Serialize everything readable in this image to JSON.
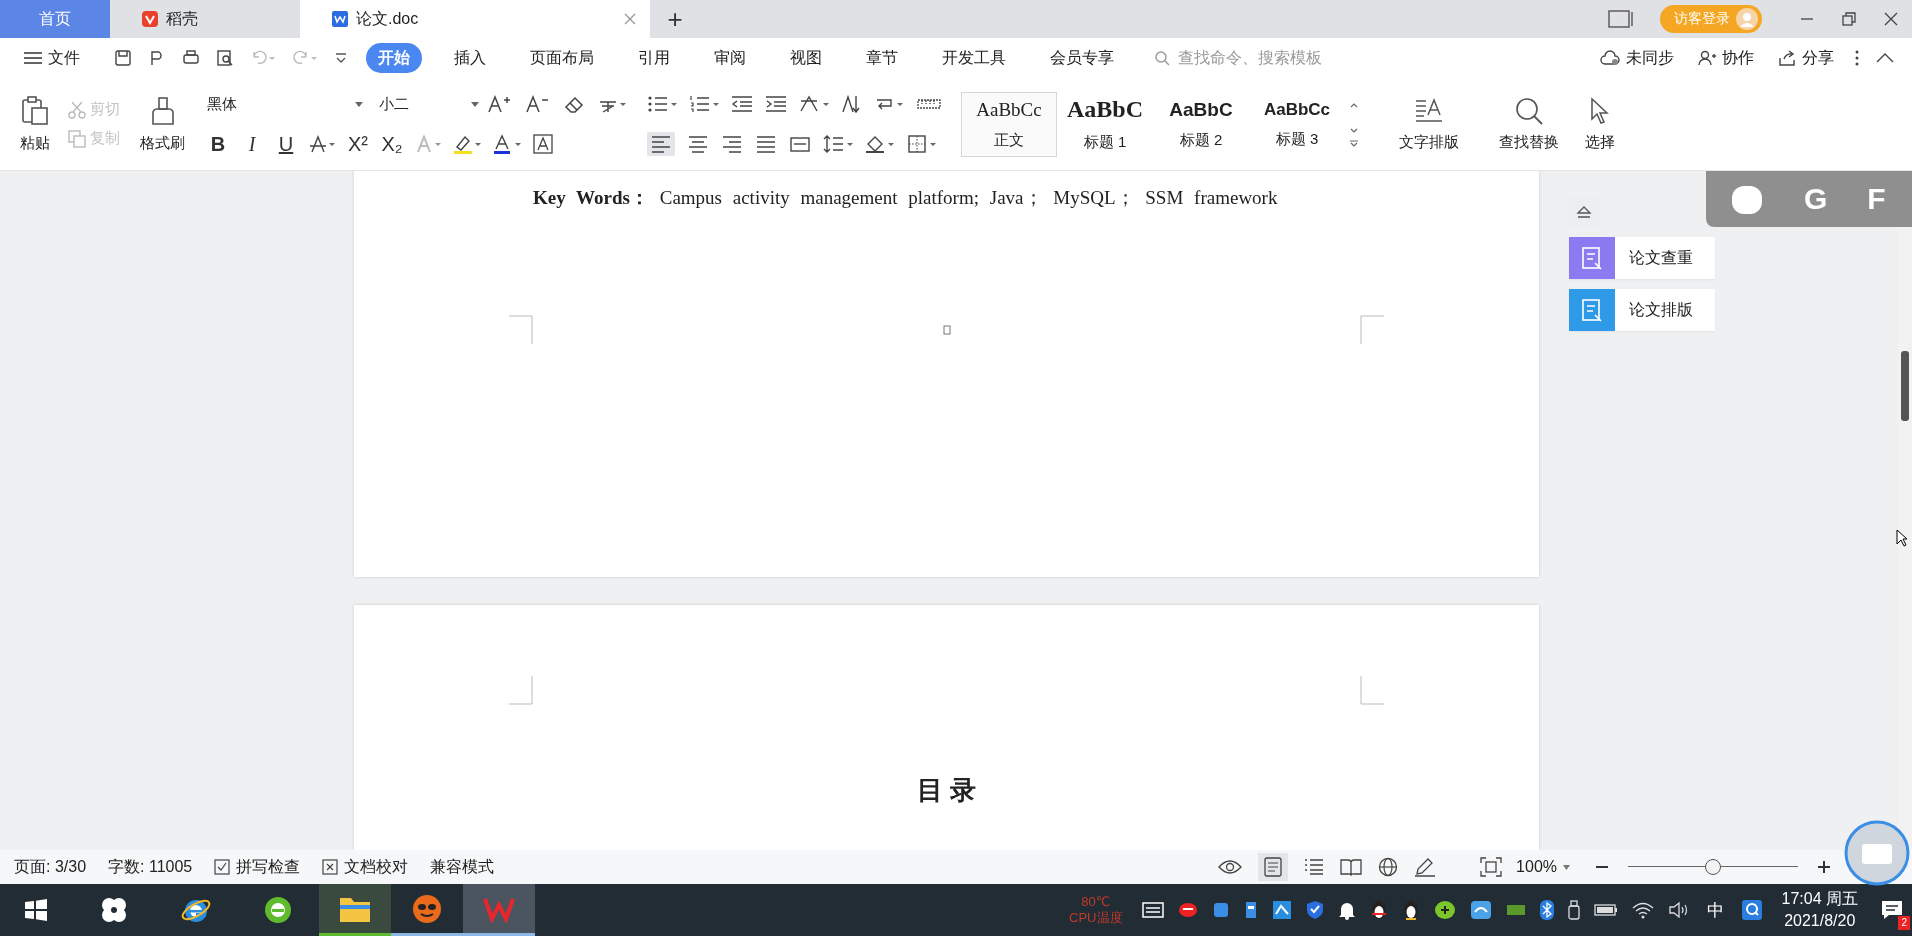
{
  "tabs": [
    {
      "label": "首页",
      "kind": "home",
      "selected": false
    },
    {
      "label": "稻壳",
      "kind": "app",
      "selected": false
    },
    {
      "label": "论文.doc",
      "kind": "doc",
      "selected": true
    }
  ],
  "new_tab": "+",
  "account_button": "访客登录",
  "menu": {
    "file": "文件",
    "items": [
      {
        "label": "开始",
        "selected": true
      },
      {
        "label": "插入",
        "selected": false
      },
      {
        "label": "页面布局",
        "selected": false
      },
      {
        "label": "引用",
        "selected": false
      },
      {
        "label": "审阅",
        "selected": false
      },
      {
        "label": "视图",
        "selected": false
      },
      {
        "label": "章节",
        "selected": false
      },
      {
        "label": "开发工具",
        "selected": false
      },
      {
        "label": "会员专享",
        "selected": false
      }
    ],
    "search": {
      "placeholder": "查找命令、搜索模板"
    },
    "sync": "未同步",
    "collab": "协作",
    "share": "分享"
  },
  "ribbon": {
    "paste": "粘贴",
    "cut": "剪切",
    "copy": "复制",
    "format_painter": "格式刷",
    "font": "黑体",
    "font_size": "小二",
    "bold": "B",
    "italic": "I",
    "underline": "U",
    "superscript": "X²",
    "subscript": "X₂",
    "styles": [
      {
        "preview": "AaBbCc",
        "name": "正文",
        "kind": "body",
        "selected": true
      },
      {
        "preview": "AaBbC",
        "name": "标题 1",
        "kind": "h1",
        "selected": false
      },
      {
        "preview": "AaBbC",
        "name": "标题 2",
        "kind": "h2",
        "selected": false
      },
      {
        "preview": "AaBbCc",
        "name": "标题 3",
        "kind": "h3",
        "selected": false
      }
    ],
    "text_layout": "文字排版",
    "find_replace": "查找替换",
    "select": "选择"
  },
  "document": {
    "keywords": "**Key Words：** Campus activity management platform; Java；  MySQL；  SSM framework",
    "heading": "目 录"
  },
  "side_panel": [
    {
      "label": "论文查重",
      "color": "#8a7cf0"
    },
    {
      "label": "论文排版",
      "color": "#2f9be8"
    }
  ],
  "recorder_toolbar": [
    "G",
    "F"
  ],
  "status_bar": {
    "page": "页面: 3/30",
    "words": "字数: 11005",
    "spell_check": "拼写检查",
    "proofread": "文档校对",
    "compat": "兼容模式",
    "zoom": "100%",
    "zoom_slider": {
      "level": 0.5
    }
  },
  "taskbar": {
    "cpu_temp": "80℃",
    "cpu_label": "CPU温度",
    "ime": "中",
    "time": "17:04 周五",
    "date": "2021/8/20",
    "notifications": "2"
  }
}
